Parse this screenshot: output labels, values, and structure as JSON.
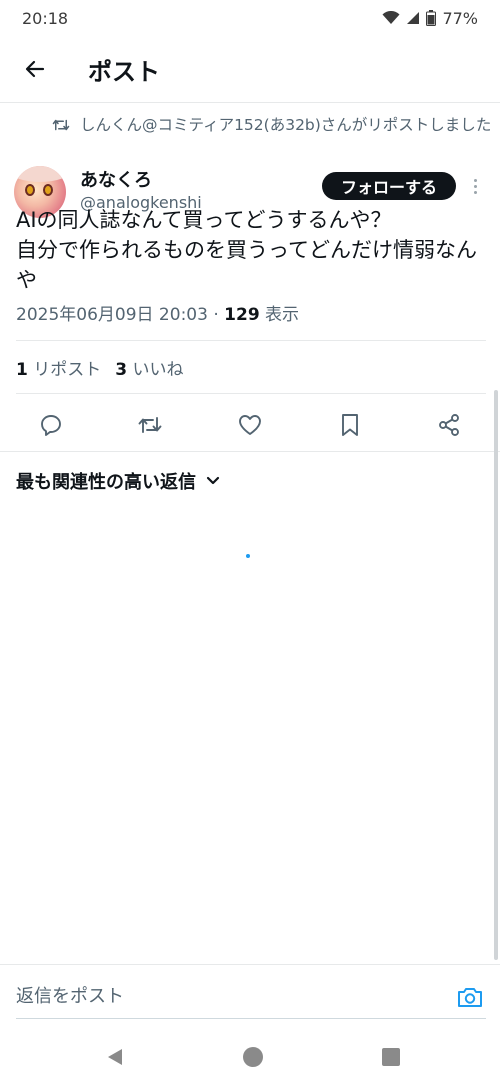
{
  "status_bar": {
    "time": "20:18",
    "battery": "77%"
  },
  "header": {
    "title": "ポスト"
  },
  "post": {
    "repost_notice": "しんくん@コミティア152(あ32b)さんがリポストしました",
    "author_name": "あなくろ",
    "author_handle": "@analogkenshi",
    "follow_label": "フォローする",
    "text": "AIの同人誌なんて買ってどうするんや？\n自分で作られるものを買うってどんだけ情弱なんや",
    "timestamp": "2025年06月09日 20:03",
    "meta_separator": " · ",
    "views_count": "129",
    "views_label": " 表示",
    "reposts_count": "1",
    "reposts_label": " リポスト",
    "likes_count": "3",
    "likes_label": " いいね"
  },
  "replies": {
    "sort_label": "最も関連性の高い返信"
  },
  "composer": {
    "placeholder": "返信をポスト"
  },
  "icons": {
    "back": "arrow-left-icon",
    "repost": "repost-icon",
    "reply": "speech-bubble-icon",
    "like": "heart-icon",
    "bookmark": "bookmark-icon",
    "share": "share-icon",
    "camera": "camera-icon"
  },
  "colors": {
    "accent": "#1d9bf0",
    "text_primary": "#0f1419",
    "text_secondary": "#536471",
    "follow_bg": "#0f1419"
  }
}
